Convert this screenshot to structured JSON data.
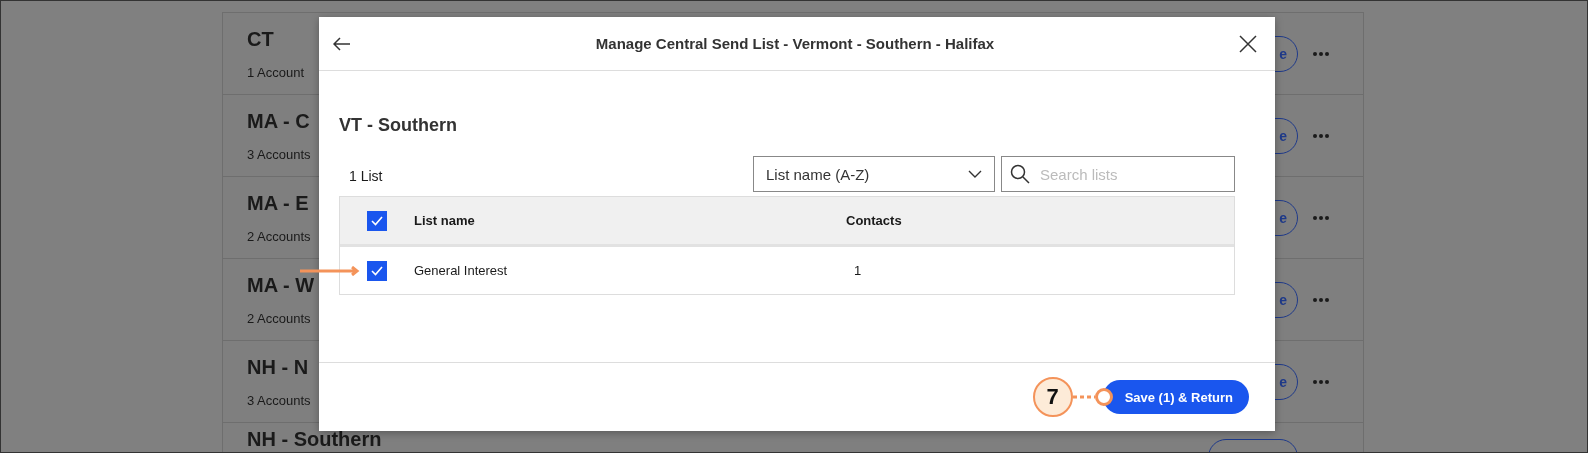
{
  "background_list": {
    "rows": [
      {
        "title": "CT",
        "count": "1 Account",
        "button": "e"
      },
      {
        "title": "MA - C",
        "count": "3 Accounts",
        "button": "e"
      },
      {
        "title": "MA - E",
        "count": "2 Accounts",
        "button": "e"
      },
      {
        "title": "MA - W",
        "count": "2 Accounts",
        "button": "e"
      },
      {
        "title": "NH - N",
        "count": "3 Accounts",
        "button": "e"
      },
      {
        "title": "NH - Southern"
      }
    ]
  },
  "modal": {
    "title": "Manage Central Send List - Vermont - Southern - Halifax",
    "section_title": "VT - Southern",
    "list_count": "1 List",
    "sort": {
      "value": "List name (A-Z)"
    },
    "search": {
      "placeholder": "Search lists"
    },
    "table": {
      "select_all": {
        "checked": true
      },
      "columns": [
        "List name",
        "Contacts"
      ],
      "rows": [
        {
          "checked": true,
          "name": "General Interest",
          "contacts": "1"
        }
      ]
    },
    "save_button": "Save (1) & Return"
  },
  "callout": {
    "step": "7"
  }
}
